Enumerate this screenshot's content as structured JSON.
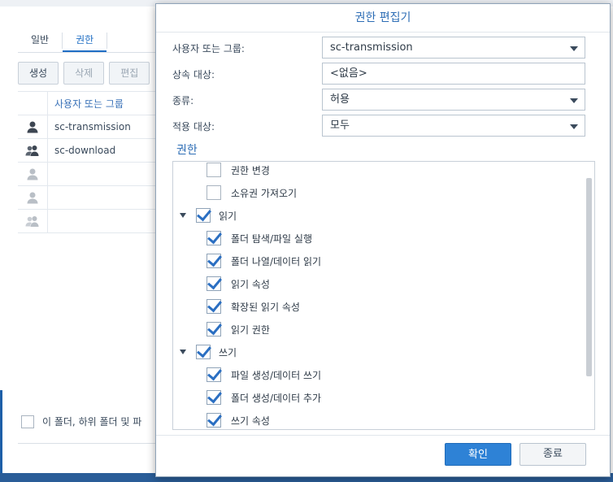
{
  "background_window": {
    "tabs": [
      {
        "label": "일반",
        "active": false
      },
      {
        "label": "권한",
        "active": true
      }
    ],
    "toolbar": {
      "create_label": "생성",
      "delete_label": "삭제",
      "edit_label": "편집"
    },
    "table": {
      "header": "사용자 또는 그룹",
      "rows": [
        {
          "name": "sc-transmission",
          "icon": "user-icon"
        },
        {
          "name": "sc-download",
          "icon": "group-icon"
        },
        {
          "name": "",
          "icon": "user-icon"
        },
        {
          "name": "",
          "icon": "user-icon"
        },
        {
          "name": "",
          "icon": "group-icon"
        }
      ]
    },
    "apply_checkbox_label": "이 폴더, 하위 폴더 및 파"
  },
  "dialog": {
    "title": "권한 편집기",
    "fields": {
      "user_or_group": {
        "label": "사용자 또는 그룹:",
        "value": "sc-transmission"
      },
      "inherit_from": {
        "label": "상속 대상:",
        "value": "<없음>"
      },
      "type": {
        "label": "종류:",
        "value": "허용"
      },
      "apply_to": {
        "label": "적용 대상:",
        "value": "모두"
      }
    },
    "permissions_heading": "권한",
    "permissions": {
      "change_permissions": {
        "label": "권한 변경",
        "checked": false
      },
      "take_ownership": {
        "label": "소유권 가져오기",
        "checked": false
      },
      "read": {
        "label": "읽기",
        "checked": true
      },
      "traverse_execute": {
        "label": "폴더 탐색/파일 실행",
        "checked": true
      },
      "list_read_data": {
        "label": "폴더 나열/데이터 읽기",
        "checked": true
      },
      "read_attributes": {
        "label": "읽기 속성",
        "checked": true
      },
      "read_extended_attributes": {
        "label": "확장된 읽기 속성",
        "checked": true
      },
      "read_permissions": {
        "label": "읽기 권한",
        "checked": true
      },
      "write": {
        "label": "쓰기",
        "checked": true
      },
      "create_files_write_data": {
        "label": "파일 생성/데이터 쓰기",
        "checked": true
      },
      "create_folders_append_data": {
        "label": "폴더 생성/데이터 추가",
        "checked": true
      },
      "write_attributes": {
        "label": "쓰기 속성",
        "checked": true
      }
    },
    "buttons": {
      "ok_label": "확인",
      "close_label": "종료"
    },
    "colors": {
      "accent": "#2e82d6",
      "title_text": "#2d6db5"
    }
  }
}
